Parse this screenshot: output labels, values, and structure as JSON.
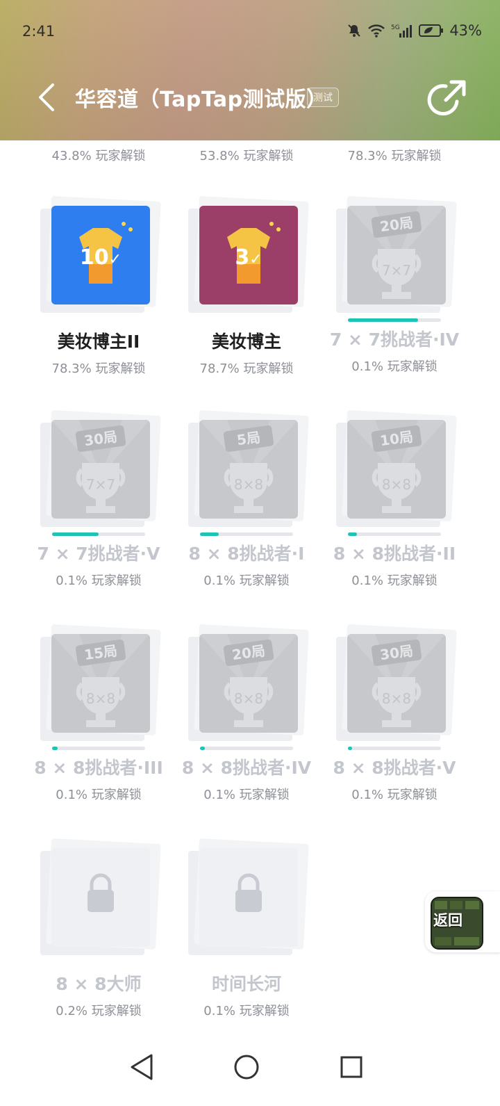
{
  "status_bar": {
    "time": "2:41",
    "battery": "43%",
    "network": "5G"
  },
  "header": {
    "title": "华容道（TapTap测试版）",
    "badge": "测试"
  },
  "top_stats": [
    "43.8% 玩家解锁",
    "53.8% 玩家解锁",
    "78.3% 玩家解锁"
  ],
  "achievements": [
    {
      "name": "美妆博主II",
      "stat": "78.3% 玩家解锁",
      "unlocked": true,
      "badge_count": "10",
      "color": "#2f7ef0"
    },
    {
      "name": "美妆博主",
      "stat": "78.7% 玩家解锁",
      "unlocked": true,
      "badge_count": "3",
      "color": "#9c3f68"
    },
    {
      "name": "7 × 7挑战者·IV",
      "stat": "0.1% 玩家解锁",
      "unlocked": false,
      "tag": "20局",
      "grid": "7×7",
      "progress": 0.75
    },
    {
      "name": "7 × 7挑战者·V",
      "stat": "0.1% 玩家解锁",
      "unlocked": false,
      "tag": "30局",
      "grid": "7×7",
      "progress": 0.5
    },
    {
      "name": "8 × 8挑战者·I",
      "stat": "0.1% 玩家解锁",
      "unlocked": false,
      "tag": "5局",
      "grid": "8×8",
      "progress": 0.2
    },
    {
      "name": "8 × 8挑战者·II",
      "stat": "0.1% 玩家解锁",
      "unlocked": false,
      "tag": "10局",
      "grid": "8×8",
      "progress": 0.1
    },
    {
      "name": "8 × 8挑战者·III",
      "stat": "0.1% 玩家解锁",
      "unlocked": false,
      "tag": "15局",
      "grid": "8×8",
      "progress": 0.06
    },
    {
      "name": "8 × 8挑战者·IV",
      "stat": "0.1% 玩家解锁",
      "unlocked": false,
      "tag": "20局",
      "grid": "8×8",
      "progress": 0.05
    },
    {
      "name": "8 × 8挑战者·V",
      "stat": "0.1% 玩家解锁",
      "unlocked": false,
      "tag": "30局",
      "grid": "8×8",
      "progress": 0.03
    },
    {
      "name": "8 × 8大师",
      "stat": "0.2% 玩家解锁",
      "unlocked": false,
      "hidden": true
    },
    {
      "name": "时间长河",
      "stat": "0.1% 玩家解锁",
      "unlocked": false,
      "hidden": true
    }
  ],
  "return_button": {
    "label": "返回"
  }
}
